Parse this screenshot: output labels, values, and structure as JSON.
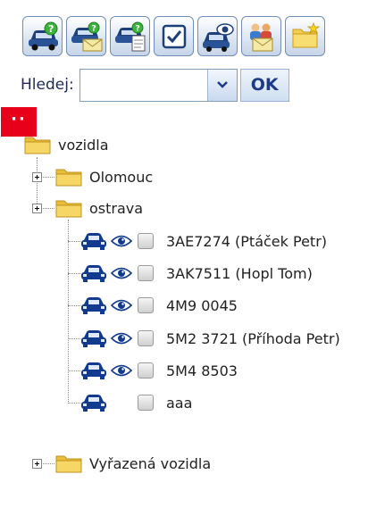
{
  "toolbar": {
    "buttons": [
      {
        "name": "car-question-icon"
      },
      {
        "name": "car-question-mail-icon"
      },
      {
        "name": "car-question-document-icon"
      },
      {
        "name": "checkbox-icon"
      },
      {
        "name": "car-eye-icon"
      },
      {
        "name": "people-mail-icon"
      },
      {
        "name": "new-folder-icon"
      }
    ]
  },
  "search": {
    "label": "Hledej:",
    "value": "",
    "button": "OK"
  },
  "collapse_marker": "··",
  "tree": {
    "root": {
      "label": "vozidla"
    },
    "groups": [
      {
        "label": "Olomouc",
        "expanded": false
      },
      {
        "label": "ostrava",
        "expanded": true
      }
    ],
    "vehicles": [
      {
        "label": "3AE7274 (Ptáček Petr)",
        "watch": true
      },
      {
        "label": "3AK7511 (Hopl Tom)",
        "watch": true
      },
      {
        "label": "4M9 0045",
        "watch": true
      },
      {
        "label": "5M2 3721 (Příhoda Petr)",
        "watch": true
      },
      {
        "label": "5M4 8503",
        "watch": true
      },
      {
        "label": "aaa",
        "watch": false
      }
    ],
    "retired": {
      "label": "Vyřazená vozidla",
      "expanded": false
    }
  },
  "colors": {
    "car": "#123a8f",
    "folder": "#f2cf4f",
    "folder_dark": "#d9a81c",
    "ok_text": "#1d3a8a",
    "marker": "#e8001b"
  }
}
